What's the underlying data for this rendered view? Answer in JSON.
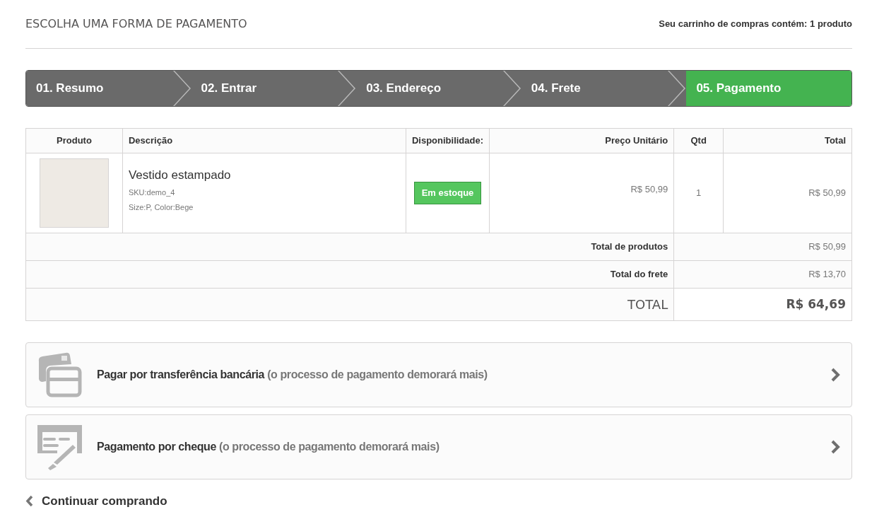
{
  "page": {
    "title": "ESCOLHA UMA FORMA DE PAGAMENTO",
    "cart_summary": "Seu carrinho de compras contém: 1 produto"
  },
  "steps": [
    {
      "label": "01. Resumo",
      "selected": false
    },
    {
      "label": "02. Entrar",
      "selected": false
    },
    {
      "label": "03. Endereço",
      "selected": false
    },
    {
      "label": "04. Frete",
      "selected": false
    },
    {
      "label": "05. Pagamento",
      "selected": true
    }
  ],
  "table": {
    "columns": [
      "Produto",
      "Descrição",
      "Disponibilidade:",
      "Preço Unitário",
      "Qtd",
      "Total"
    ],
    "rows": [
      {
        "name": "Vestido estampado",
        "sku": "SKU:demo_4",
        "attributes": "Size:P, Color:Bege",
        "availability": "Em estoque",
        "unit_price": "R$ 50,99",
        "quantity": "1",
        "total": "R$ 50,99"
      }
    ],
    "summary": [
      {
        "label": "Total de produtos",
        "value": "R$ 50,99",
        "kind": "subtotal"
      },
      {
        "label": "Total do frete",
        "value": "R$ 13,70",
        "kind": "subtotal"
      },
      {
        "label": "TOTAL",
        "value": "R$ 64,69",
        "kind": "grand_total"
      }
    ]
  },
  "payment_options": [
    {
      "kind": "bank",
      "title": "Pagar por transferência bancária",
      "note": "(o processo de pagamento demorará mais)"
    },
    {
      "kind": "cheque",
      "title": "Pagamento por cheque",
      "note": "(o processo de pagamento demorará mais)"
    }
  ],
  "back_link": "Continuar comprando"
}
